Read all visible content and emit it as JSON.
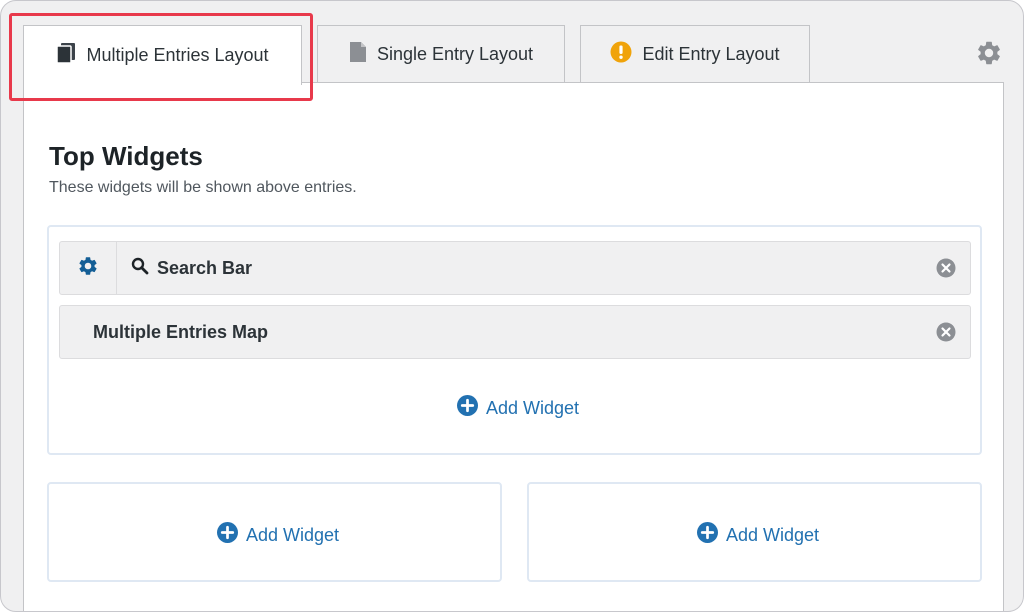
{
  "tabs": [
    {
      "label": "Multiple Entries Layout",
      "icon": "book-icon",
      "active": true
    },
    {
      "label": "Single Entry Layout",
      "icon": "document-icon",
      "active": false
    },
    {
      "label": "Edit Entry Layout",
      "icon": "warning-icon",
      "active": false
    }
  ],
  "settings_icon": "gear-icon",
  "top_widgets": {
    "title": "Top Widgets",
    "description": "These widgets will be shown above entries.",
    "widgets": [
      {
        "label": "Search Bar",
        "icon": "search-icon",
        "has_settings": true
      },
      {
        "label": "Multiple Entries Map",
        "has_settings": false
      }
    ],
    "add_label": "Add Widget"
  },
  "left_area": {
    "add_label": "Add Widget"
  },
  "right_area": {
    "add_label": "Add Widget"
  },
  "colors": {
    "accent": "#2271b1",
    "settings_blue": "#135e96",
    "warning": "#f0a30a",
    "highlight": "#e8394b",
    "gear_gray": "#8c8f94"
  }
}
